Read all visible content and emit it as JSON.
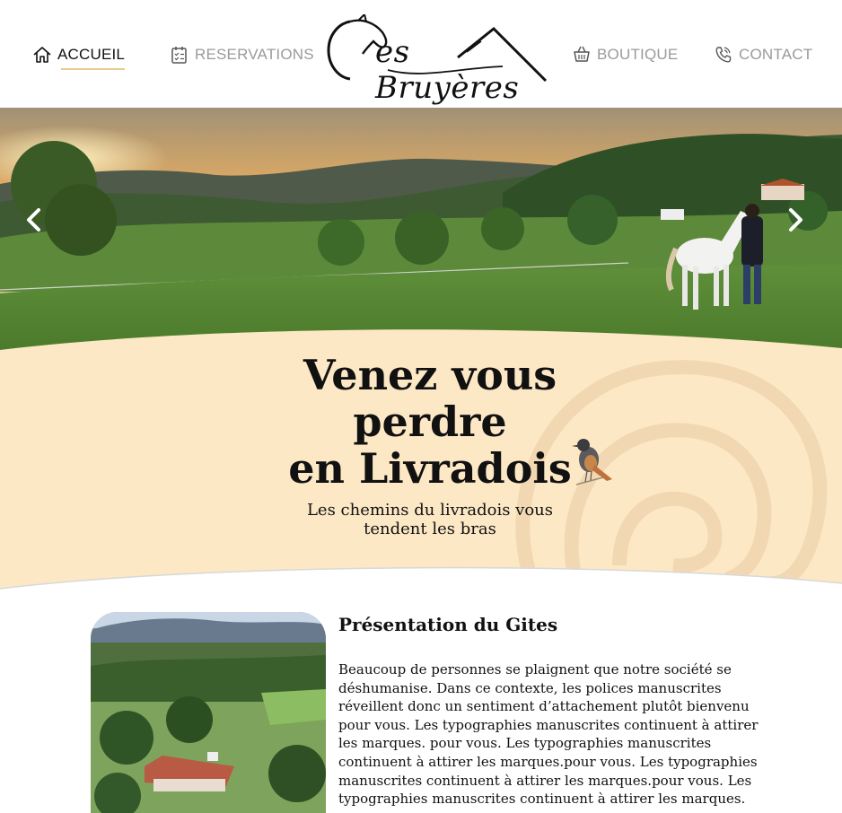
{
  "nav": {
    "home": {
      "label": "ACCUEIL",
      "icon": "home-icon",
      "active": true
    },
    "reservations": {
      "label": "RESERVATIONS",
      "icon": "calendar-icon",
      "active": false
    },
    "boutique": {
      "label": "BOUTIQUE",
      "icon": "basket-icon",
      "active": false
    },
    "contact": {
      "label": "CONTACT",
      "icon": "phone-icon",
      "active": false
    }
  },
  "logo": {
    "text": "es Bruyères",
    "icon": "horse-head-roof-logo"
  },
  "hero": {
    "prev_icon": "chevron-left-icon",
    "next_icon": "chevron-right-icon"
  },
  "tagline": {
    "line1": "Venez vous",
    "line2": "perdre",
    "line3": "en Livradois",
    "sub1": "Les chemins du livradois vous",
    "sub2": "tendent les bras"
  },
  "presentation": {
    "title": "Présentation du Gites",
    "body": "Beaucoup de personnes se plaignent que notre société se déshumanise. Dans ce contexte, les polices manuscrites réveillent donc un sentiment d’attachement plutôt bienvenu pour vous. Les typographies manuscrites continuent à attirer les marques. pour vous. Les typographies manuscrites continuent à attirer les marques.pour vous. Les typographies manuscrites continuent à attirer les marques.pour vous. Les typographies manuscrites continuent à attirer les marques."
  },
  "colors": {
    "band": "#fde8c6",
    "accent_underline": "#e9c98e",
    "nav_inactive": "#9a9a9a",
    "text": "#111111"
  }
}
